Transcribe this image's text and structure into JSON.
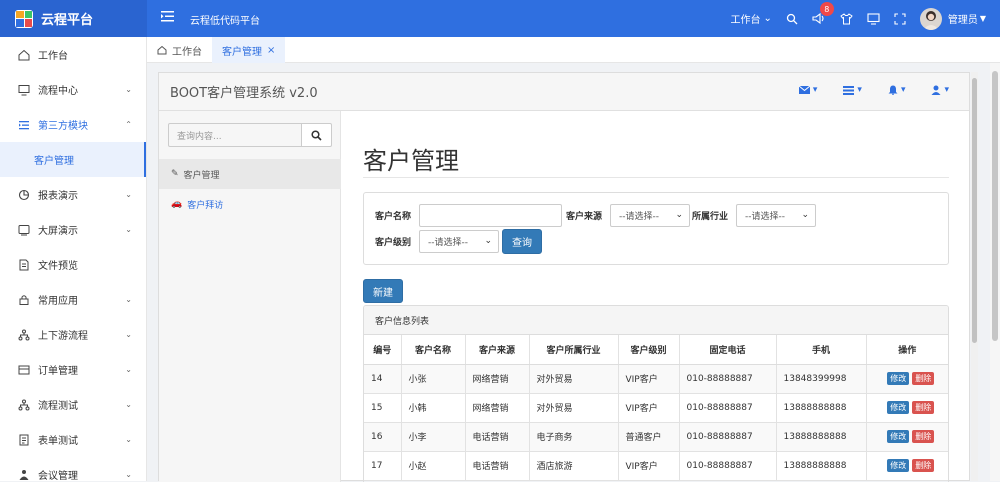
{
  "brand": {
    "title": "云程平台"
  },
  "header": {
    "platform_title": "云程低代码平台",
    "workbench": "工作台",
    "notification_count": "8",
    "user_name": "管理员"
  },
  "sidebar": {
    "items": [
      {
        "label": "工作台",
        "icon": "home-icon",
        "chevron": ""
      },
      {
        "label": "流程中心",
        "icon": "monitor-icon",
        "chevron": "⌄"
      },
      {
        "label": "第三方模块",
        "icon": "list-icon",
        "chevron": "⌃"
      },
      {
        "label": "客户管理",
        "icon": "",
        "chevron": ""
      },
      {
        "label": "报表演示",
        "icon": "chart-icon",
        "chevron": "⌄"
      },
      {
        "label": "大屏演示",
        "icon": "screen-icon",
        "chevron": "⌄"
      },
      {
        "label": "文件预览",
        "icon": "file-icon",
        "chevron": ""
      },
      {
        "label": "常用应用",
        "icon": "app-icon",
        "chevron": "⌄"
      },
      {
        "label": "上下游流程",
        "icon": "flow-icon",
        "chevron": "⌄"
      },
      {
        "label": "订单管理",
        "icon": "order-icon",
        "chevron": "⌄"
      },
      {
        "label": "流程测试",
        "icon": "flow-test-icon",
        "chevron": "⌄"
      },
      {
        "label": "表单测试",
        "icon": "form-icon",
        "chevron": "⌄"
      },
      {
        "label": "会议管理",
        "icon": "meeting-icon",
        "chevron": "⌄"
      }
    ]
  },
  "tabs": {
    "home": "工作台",
    "active": "客户管理",
    "close": "×"
  },
  "frame": {
    "title": "BOOT客户管理系统 v2.0"
  },
  "left_nav": {
    "search_placeholder": "查询内容...",
    "items": [
      "客户管理",
      "客户拜访"
    ]
  },
  "page": {
    "title": "客户管理",
    "filter": {
      "name_label": "客户名称",
      "source_label": "客户来源",
      "industry_label": "所属行业",
      "level_label": "客户级别",
      "select_placeholder": "--请选择--",
      "search_button": "查询"
    },
    "new_button": "新建",
    "table_title": "客户信息列表",
    "columns": [
      "编号",
      "客户名称",
      "客户来源",
      "客户所属行业",
      "客户级别",
      "固定电话",
      "手机",
      "操作"
    ],
    "edit_label": "修改",
    "delete_label": "删除",
    "rows": [
      [
        "14",
        "小张",
        "网络营销",
        "对外贸易",
        "VIP客户",
        "010-88888887",
        "13848399998"
      ],
      [
        "15",
        "小韩",
        "网络营销",
        "对外贸易",
        "VIP客户",
        "010-88888887",
        "13888888888"
      ],
      [
        "16",
        "小李",
        "电话营销",
        "电子商务",
        "普通客户",
        "010-88888887",
        "13888888888"
      ],
      [
        "17",
        "小赵",
        "电话营销",
        "酒店旅游",
        "VIP客户",
        "010-88888887",
        "13888888888"
      ]
    ]
  }
}
